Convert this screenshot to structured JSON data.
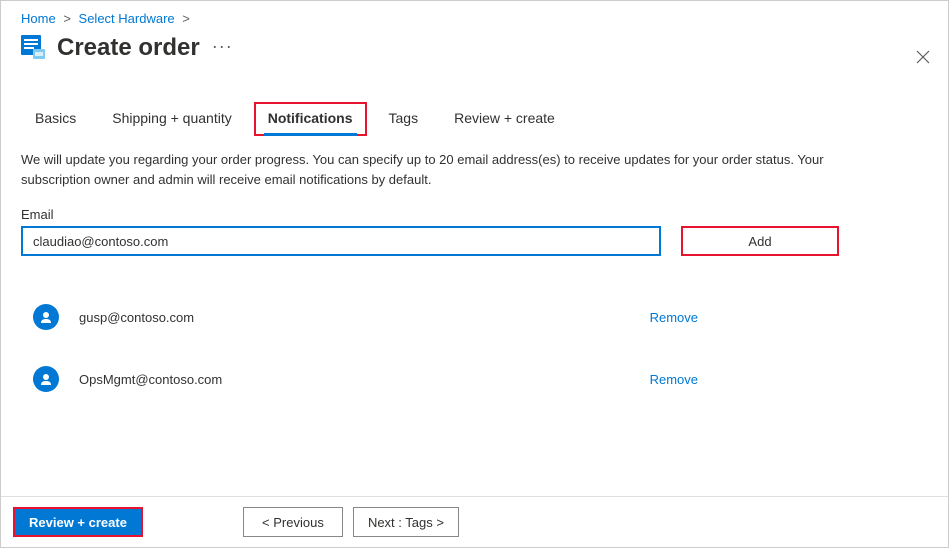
{
  "breadcrumb": {
    "home": "Home",
    "select_hardware": "Select Hardware"
  },
  "header": {
    "title": "Create order",
    "more": "···"
  },
  "tabs": {
    "basics": "Basics",
    "shipping": "Shipping + quantity",
    "notifications": "Notifications",
    "tags": "Tags",
    "review": "Review + create"
  },
  "description": "We will update you regarding your order progress. You can specify up to 20 email address(es) to receive updates for your order status. Your subscription owner and admin will receive email notifications by default.",
  "email_label": "Email",
  "email_value": "claudiao@contoso.com",
  "add_label": "Add",
  "emails": {
    "0": {
      "address": "gusp@contoso.com",
      "remove": "Remove"
    },
    "1": {
      "address": "OpsMgmt@contoso.com",
      "remove": "Remove"
    }
  },
  "footer": {
    "review": "Review + create",
    "previous": "< Previous",
    "next": "Next : Tags >"
  }
}
